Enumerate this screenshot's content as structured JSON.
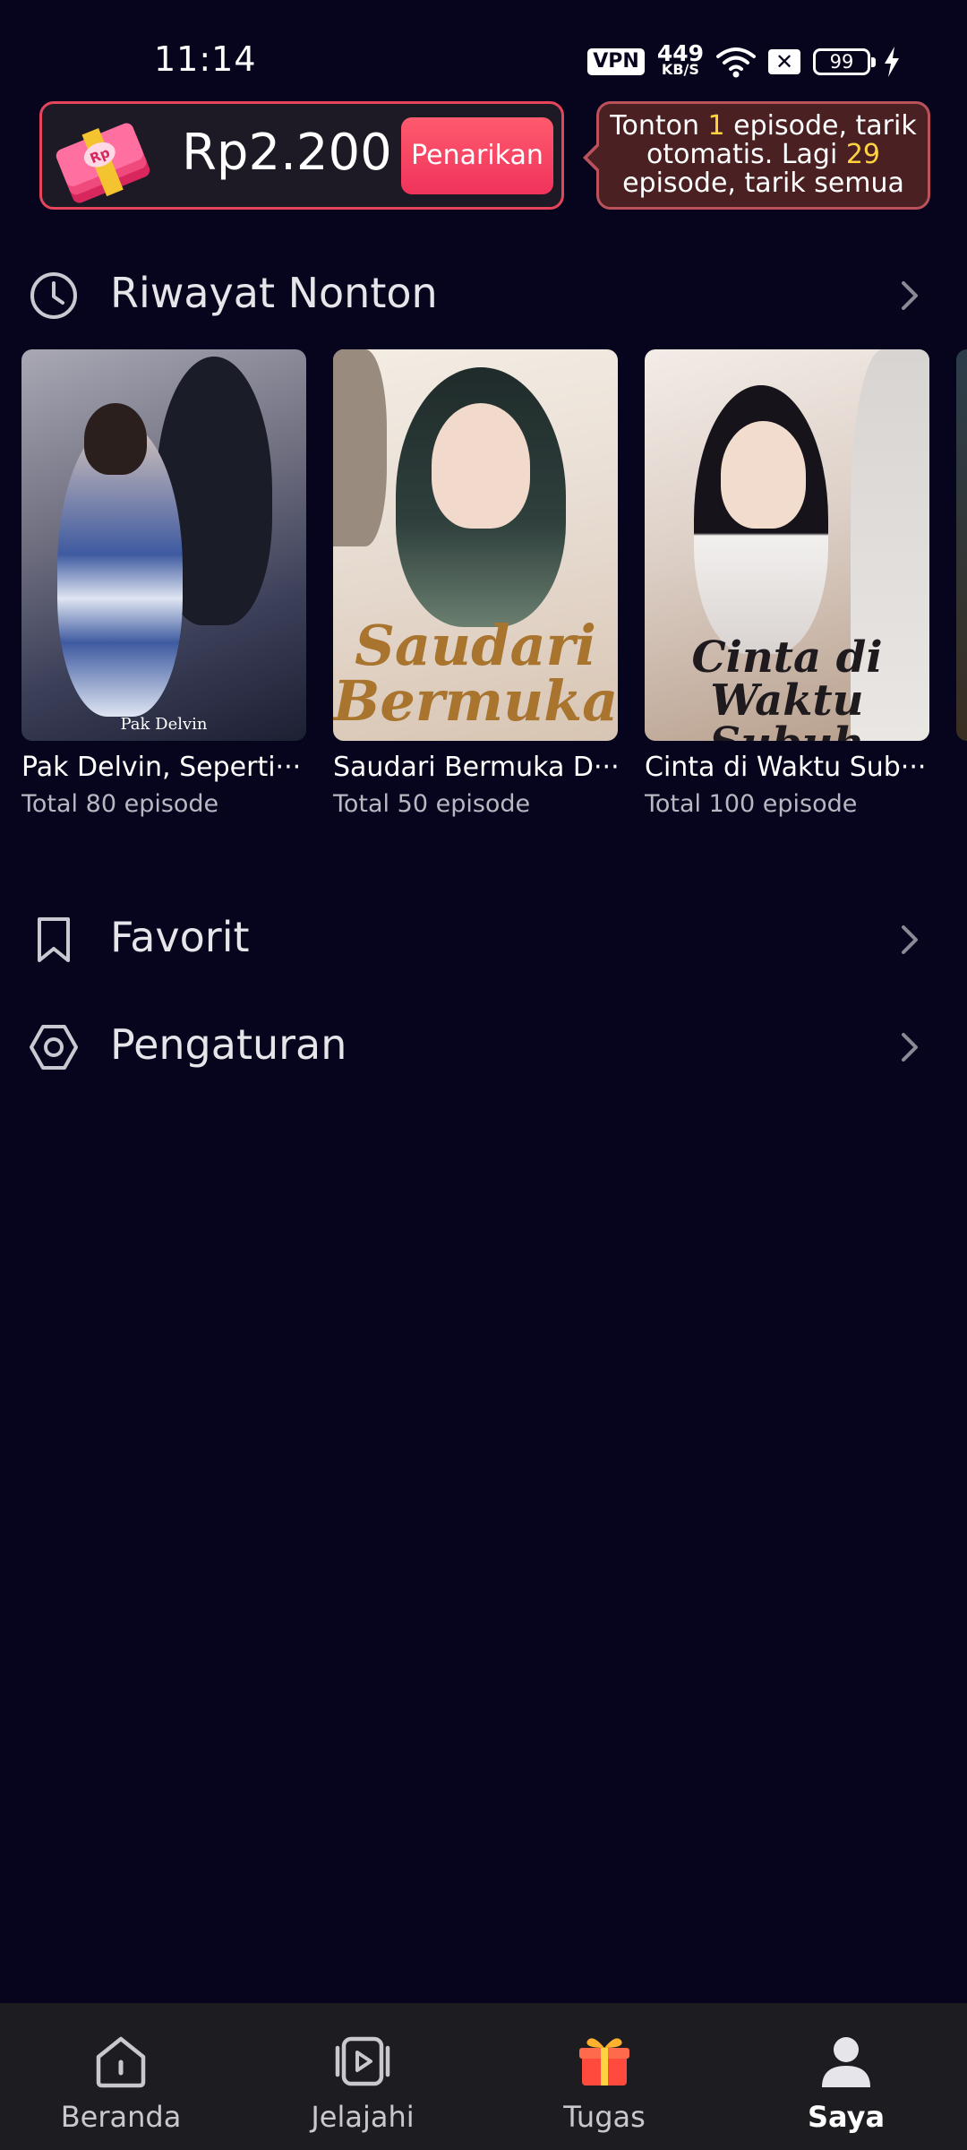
{
  "status_bar": {
    "time": "11:14",
    "vpn": "VPN",
    "net_speed_value": "449",
    "net_speed_unit": "KB/S",
    "battery": "99"
  },
  "reward": {
    "amount": "Rp2.200",
    "withdraw_label": "Penarikan",
    "tip_part1": "Tonton ",
    "tip_count1": "1",
    "tip_part2": " episode, tarik otomatis. Lagi ",
    "tip_count2": "29",
    "tip_part3": " episode, tarik semua",
    "highlight_color": "#ffd23f",
    "accent_color": "#f0335b"
  },
  "history": {
    "title": "Riwayat Nonton",
    "icon": "clock-icon",
    "items": [
      {
        "title": "Pak Delvin, Seperti···",
        "episodes": "Total 80 episode",
        "poster_caption": "Pak Delvin"
      },
      {
        "title": "Saudari Bermuka D···",
        "episodes": "Total 50 episode",
        "poster_caption": "Saudari Bermuka"
      },
      {
        "title": "Cinta di Waktu Sub···",
        "episodes": "Total 100 episode",
        "poster_caption": "Cinta di Waktu Subuh"
      }
    ]
  },
  "menu": {
    "favorites": {
      "label": "Favorit",
      "icon": "bookmark-icon"
    },
    "settings": {
      "label": "Pengaturan",
      "icon": "hexagon-settings-icon"
    }
  },
  "bottom_nav": {
    "items": [
      {
        "label": "Beranda",
        "icon": "home-icon"
      },
      {
        "label": "Jelajahi",
        "icon": "play-video-icon"
      },
      {
        "label": "Tugas",
        "icon": "gift-icon"
      },
      {
        "label": "Saya",
        "icon": "person-icon",
        "active": true
      }
    ]
  }
}
